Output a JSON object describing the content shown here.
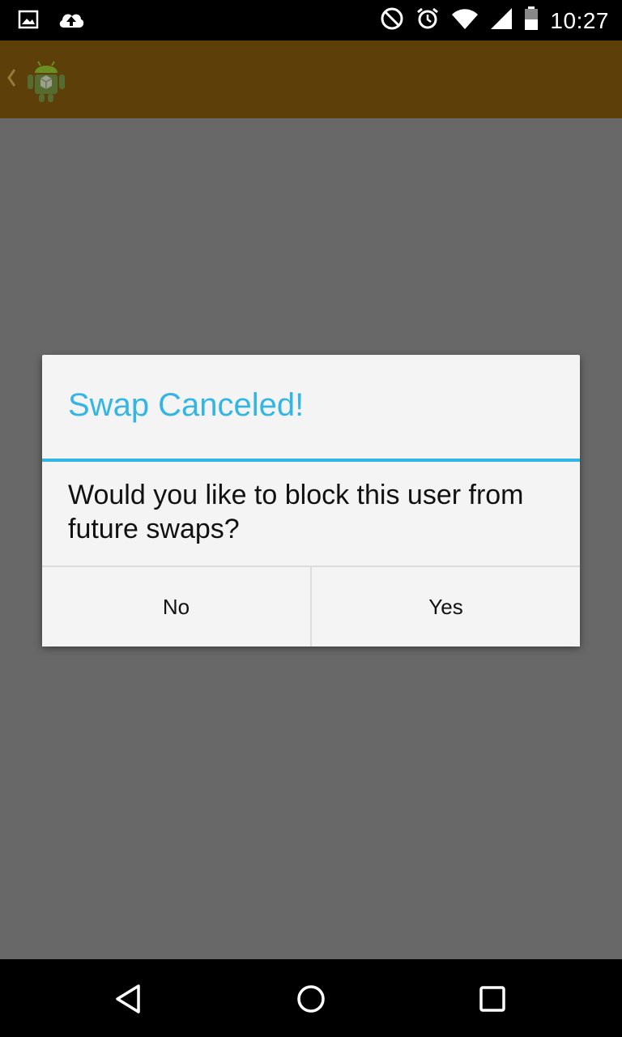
{
  "status_bar": {
    "time": "10:27",
    "icons": [
      "image-icon",
      "cloud-upload-icon",
      "do-not-disturb-icon",
      "alarm-icon",
      "wifi-icon",
      "cell-signal-icon",
      "battery-icon"
    ]
  },
  "action_bar": {
    "up_icon": "up-caret-icon",
    "app_icon": "android-app-icon",
    "background": "#5c3f09"
  },
  "dialog": {
    "title": "Swap Canceled!",
    "message": "Would you like to block this user from future swaps?",
    "buttons": {
      "no": "No",
      "yes": "Yes"
    },
    "accent_color": "#33b5e5"
  },
  "nav_bar": {
    "icons": [
      "back-icon",
      "home-icon",
      "recents-icon"
    ]
  }
}
